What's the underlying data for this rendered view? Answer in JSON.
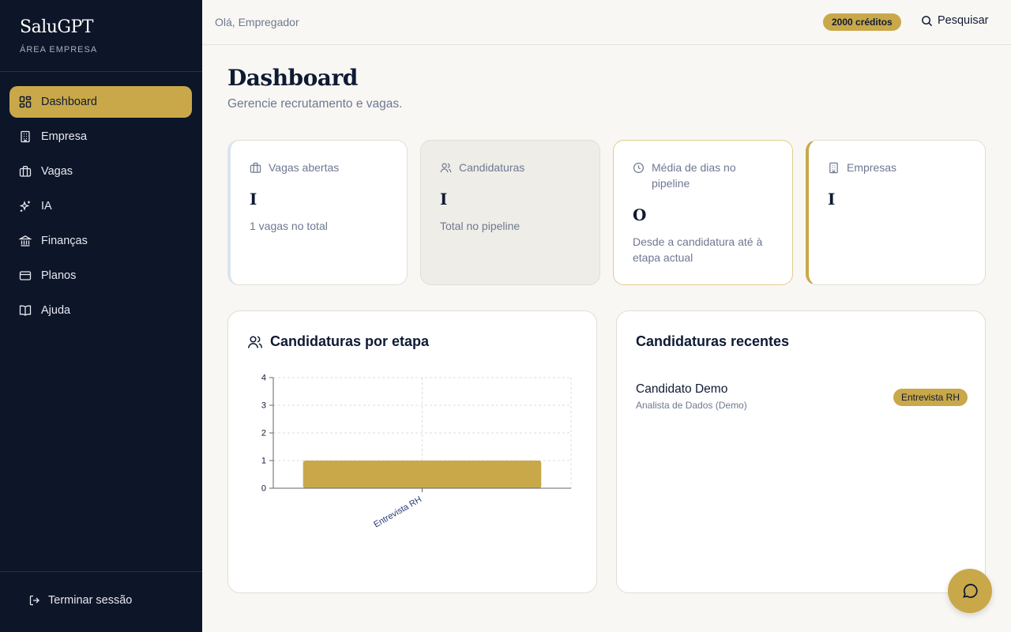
{
  "brand": {
    "name": "SaluGPT",
    "subtitle": "ÁREA EMPRESA"
  },
  "sidebar": {
    "items": [
      {
        "label": "Dashboard",
        "icon": "dashboard-icon",
        "active": true
      },
      {
        "label": "Empresa",
        "icon": "building-icon"
      },
      {
        "label": "Vagas",
        "icon": "briefcase-icon"
      },
      {
        "label": "IA",
        "icon": "sparkles-icon"
      },
      {
        "label": "Finanças",
        "icon": "bank-icon"
      },
      {
        "label": "Planos",
        "icon": "credit-card-icon"
      },
      {
        "label": "Ajuda",
        "icon": "book-icon"
      }
    ],
    "logout_label": "Terminar sessão"
  },
  "header": {
    "greeting": "Olá, Empregador",
    "credits": "2000 créditos",
    "search_label": "Pesquisar"
  },
  "main": {
    "title": "Dashboard",
    "subtitle": "Gerencie recrutamento e vagas.",
    "stats": [
      {
        "label": "Vagas abertas",
        "value": "I",
        "note": "1 vagas no total",
        "icon": "briefcase-icon"
      },
      {
        "label": "Candidaturas",
        "value": "I",
        "note": "Total no pipeline",
        "icon": "users-icon"
      },
      {
        "label": "Média de dias no pipeline",
        "value": "O",
        "note": "Desde a candidatura até à etapa actual",
        "icon": "clock-icon"
      },
      {
        "label": "Empresas",
        "value": "I",
        "note": "",
        "icon": "building-icon"
      }
    ],
    "chart_panel": {
      "title": "Candidaturas por etapa"
    },
    "recent_panel": {
      "title": "Candidaturas recentes",
      "items": [
        {
          "name": "Candidato Demo",
          "role": "Analista de Dados (Demo)",
          "stage": "Entrevista RH"
        }
      ]
    }
  },
  "chart_data": {
    "type": "bar",
    "categories": [
      "Entrevista RH"
    ],
    "values": [
      1
    ],
    "title": "Candidaturas por etapa",
    "xlabel": "",
    "ylabel": "",
    "ylim": [
      0,
      4
    ],
    "yticks": [
      "0",
      "1",
      "2",
      "3",
      "4"
    ],
    "grid": true,
    "bar_color": "#c9a84a"
  },
  "colors": {
    "sidebar_bg": "#0d1528",
    "accent": "#c9a84a",
    "page_bg": "#f8f7f3"
  }
}
